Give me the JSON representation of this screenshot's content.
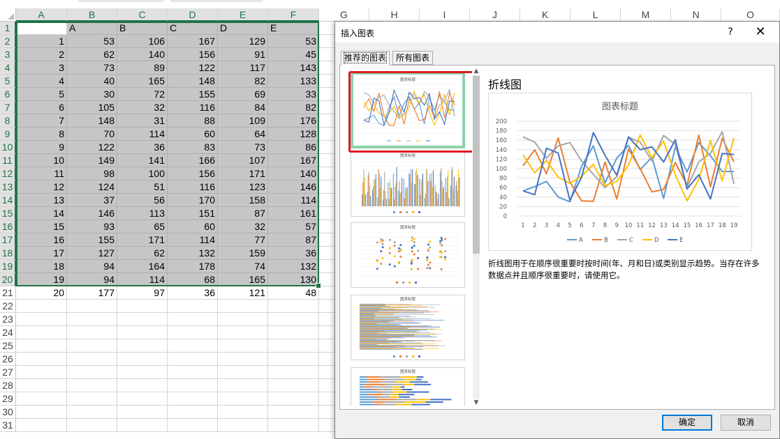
{
  "sheet": {
    "columns": [
      "A",
      "B",
      "C",
      "D",
      "E",
      "F",
      "G",
      "H",
      "I",
      "J",
      "K",
      "L",
      "M",
      "N",
      "O"
    ],
    "header_row": [
      "",
      "A",
      "B",
      "C",
      "D",
      "E"
    ],
    "rows": [
      [
        1,
        53,
        106,
        167,
        129,
        53
      ],
      [
        2,
        62,
        140,
        156,
        91,
        45
      ],
      [
        3,
        73,
        89,
        122,
        117,
        143
      ],
      [
        4,
        40,
        165,
        148,
        82,
        133
      ],
      [
        5,
        30,
        72,
        155,
        69,
        33
      ],
      [
        6,
        105,
        32,
        116,
        84,
        82
      ],
      [
        7,
        148,
        31,
        88,
        109,
        176
      ],
      [
        8,
        70,
        114,
        60,
        64,
        128
      ],
      [
        9,
        122,
        36,
        83,
        73,
        86
      ],
      [
        10,
        149,
        141,
        166,
        107,
        167
      ],
      [
        11,
        98,
        100,
        156,
        171,
        140
      ],
      [
        12,
        124,
        51,
        116,
        123,
        146
      ],
      [
        13,
        37,
        56,
        170,
        158,
        114
      ],
      [
        14,
        146,
        113,
        151,
        87,
        161
      ],
      [
        15,
        93,
        65,
        60,
        32,
        57
      ],
      [
        16,
        155,
        171,
        114,
        77,
        87
      ],
      [
        17,
        127,
        62,
        132,
        159,
        36
      ],
      [
        18,
        94,
        164,
        178,
        74,
        132
      ],
      [
        19,
        94,
        114,
        68,
        165,
        130
      ],
      [
        20,
        177,
        97,
        36,
        121,
        48
      ]
    ],
    "row_numbers": [
      1,
      2,
      3,
      4,
      5,
      6,
      7,
      8,
      9,
      10,
      11,
      12,
      13,
      14,
      15,
      16,
      17,
      18,
      19,
      20,
      21,
      22,
      23,
      24,
      25,
      26,
      27,
      28,
      29,
      30,
      31
    ]
  },
  "dialog": {
    "title": "插入图表",
    "help_label": "?",
    "close_label": "✕",
    "tabs": [
      "推荐的图表",
      "所有图表"
    ],
    "preview_title": "折线图",
    "description": "折线图用于在顺序很重要时按时间(年、月和日)或类别显示趋势。当存在许多数据点并且顺序很重要时，请使用它。",
    "ok_label": "确定",
    "cancel_label": "取消",
    "thumbnail_title": "图表标题",
    "scroll_up": "▲",
    "scroll_down": "▼"
  },
  "chart_data": {
    "type": "line",
    "title": "图表标题",
    "x": [
      1,
      2,
      3,
      4,
      5,
      6,
      7,
      8,
      9,
      10,
      11,
      12,
      13,
      14,
      15,
      16,
      17,
      18,
      19
    ],
    "ylim": [
      0,
      200
    ],
    "yticks": [
      0,
      20,
      40,
      60,
      80,
      100,
      120,
      140,
      160,
      180,
      200
    ],
    "grid": true,
    "legend_position": "bottom",
    "series": [
      {
        "name": "A",
        "color": "#5b9bd5",
        "values": [
          53,
          62,
          73,
          40,
          30,
          105,
          148,
          70,
          122,
          149,
          98,
          124,
          37,
          146,
          93,
          155,
          127,
          94,
          94
        ]
      },
      {
        "name": "B",
        "color": "#ed7d31",
        "values": [
          106,
          140,
          89,
          165,
          72,
          32,
          31,
          114,
          36,
          141,
          100,
          51,
          56,
          113,
          65,
          171,
          62,
          164,
          114
        ]
      },
      {
        "name": "C",
        "color": "#a5a5a5",
        "values": [
          167,
          156,
          122,
          148,
          155,
          116,
          88,
          60,
          83,
          166,
          156,
          116,
          170,
          151,
          60,
          114,
          132,
          178,
          68
        ]
      },
      {
        "name": "D",
        "color": "#ffc000",
        "values": [
          129,
          91,
          117,
          82,
          69,
          84,
          109,
          64,
          73,
          107,
          171,
          123,
          158,
          87,
          32,
          77,
          159,
          74,
          165
        ]
      },
      {
        "name": "E",
        "color": "#4472c4",
        "values": [
          53,
          45,
          143,
          133,
          33,
          82,
          176,
          128,
          86,
          167,
          140,
          146,
          114,
          161,
          57,
          87,
          36,
          132,
          130
        ]
      }
    ]
  }
}
